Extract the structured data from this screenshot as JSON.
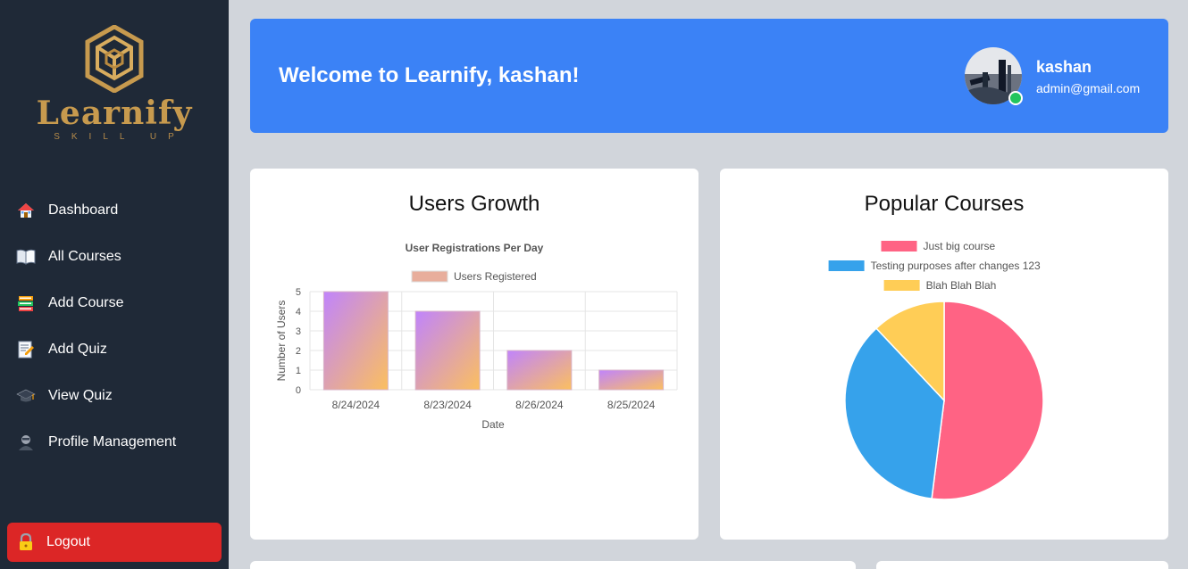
{
  "brand": {
    "name": "Learnify",
    "tagline": "SKILL UP"
  },
  "sidebar": {
    "items": [
      {
        "label": "Dashboard",
        "icon": "house-icon"
      },
      {
        "label": "All Courses",
        "icon": "open-book-icon"
      },
      {
        "label": "Add Course",
        "icon": "books-icon"
      },
      {
        "label": "Add Quiz",
        "icon": "memo-icon"
      },
      {
        "label": "View Quiz",
        "icon": "graduation-cap-icon"
      },
      {
        "label": "Profile Management",
        "icon": "user-icon"
      }
    ],
    "logout_label": "Logout"
  },
  "banner": {
    "welcome": "Welcome to Learnify, kashan!",
    "user_name": "kashan",
    "user_email": "admin@gmail.com"
  },
  "cards": {
    "growth_title": "Users Growth",
    "popular_title": "Popular Courses"
  },
  "chart_data": [
    {
      "type": "bar",
      "title": "User Registrations Per Day",
      "xlabel": "Date",
      "ylabel": "Number of Users",
      "categories": [
        "8/24/2024",
        "8/23/2024",
        "8/26/2024",
        "8/25/2024"
      ],
      "series": [
        {
          "name": "Users Registered",
          "values": [
            5,
            4,
            2,
            1
          ]
        }
      ],
      "ylim": [
        0,
        5
      ],
      "grid": true,
      "legend": "top"
    },
    {
      "type": "pie",
      "labels": [
        "Just big course",
        "Testing purposes after changes 123",
        "Blah Blah Blah"
      ],
      "values": [
        52,
        36,
        12
      ],
      "colors": [
        "#ff6384",
        "#36a2eb",
        "#ffcd56"
      ],
      "legend": "top"
    }
  ],
  "colors": {
    "sidebar": "#1f2937",
    "banner": "#3b82f6",
    "logout": "#dc2626"
  }
}
